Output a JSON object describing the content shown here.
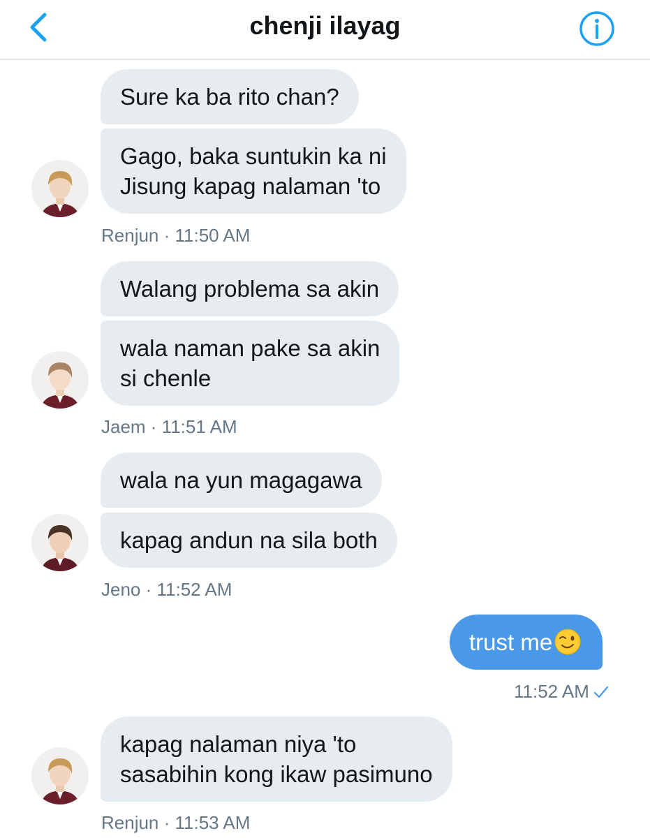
{
  "header": {
    "title": "chenji ilayag"
  },
  "colors": {
    "accent": "#1da1f2",
    "sent_bubble": "#4a99e9",
    "received_bubble": "#e6ecf0",
    "meta_text": "#657786"
  },
  "groups": [
    {
      "messages": [
        "Sure ka ba rito chan?",
        "Gago, baka suntukin ka ni\nJisung kapag nalaman 'to"
      ],
      "meta": "Renjun · 11:50 AM"
    },
    {
      "messages": [
        "Walang problema sa akin",
        "wala naman pake sa akin\nsi chenle"
      ],
      "meta": "Jaem · 11:51 AM"
    },
    {
      "messages": [
        "wala na yun magagawa",
        "kapag andun na sila both"
      ],
      "meta": "Jeno · 11:52 AM"
    },
    {
      "sent": true,
      "messages": [
        "trust me"
      ],
      "emoji": "winking-face",
      "meta": "11:52 AM"
    },
    {
      "messages": [
        "kapag nalaman niya 'to\nsasabihin kong ikaw pasimuno"
      ],
      "meta": "Renjun · 11:53 AM"
    }
  ],
  "icons": {
    "back": "chevron-left-icon",
    "info": "info-icon",
    "read_receipt": "checkmark-icon"
  }
}
